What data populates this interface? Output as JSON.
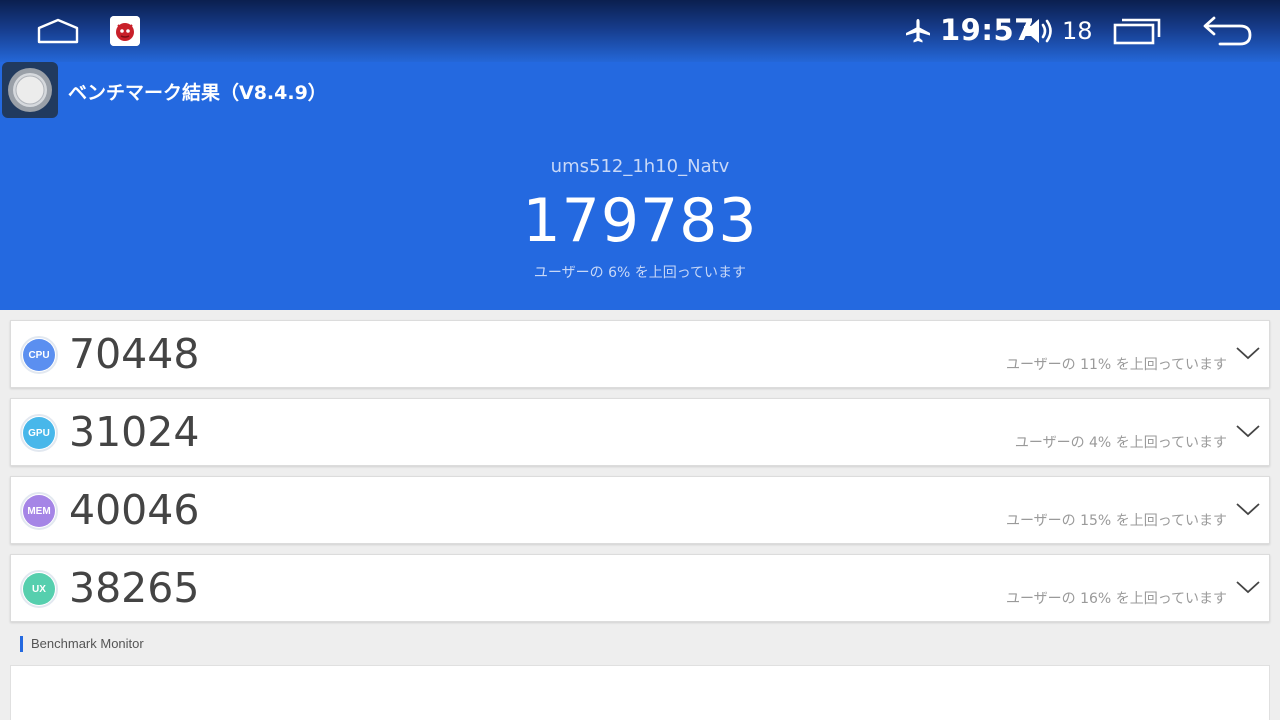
{
  "status_bar": {
    "time": "19:57",
    "volume_level": "18",
    "icons": [
      "home-icon",
      "antutu-app-icon",
      "airplane-mode-icon",
      "volume-icon",
      "recent-apps-icon",
      "back-icon"
    ]
  },
  "header": {
    "title": "ベンチマーク結果（V8.4.9）",
    "device_name": "ums512_1h10_Natv",
    "total_score": "179783",
    "percentile_text": "ユーザーの 6% を上回っています",
    "background_color": "#2469e0"
  },
  "scores": [
    {
      "badge": "CPU",
      "score": "70448",
      "percentile_text": "ユーザーの 11% を上回っています",
      "color": "#5b8ff0"
    },
    {
      "badge": "GPU",
      "score": "31024",
      "percentile_text": "ユーザーの 4% を上回っています",
      "color": "#48b7ea"
    },
    {
      "badge": "MEM",
      "score": "40046",
      "percentile_text": "ユーザーの 15% を上回っています",
      "color": "#a585e6"
    },
    {
      "badge": "UX",
      "score": "38265",
      "percentile_text": "ユーザーの 16% を上回っています",
      "color": "#56cfae"
    }
  ],
  "monitor": {
    "label": "Benchmark Monitor"
  }
}
